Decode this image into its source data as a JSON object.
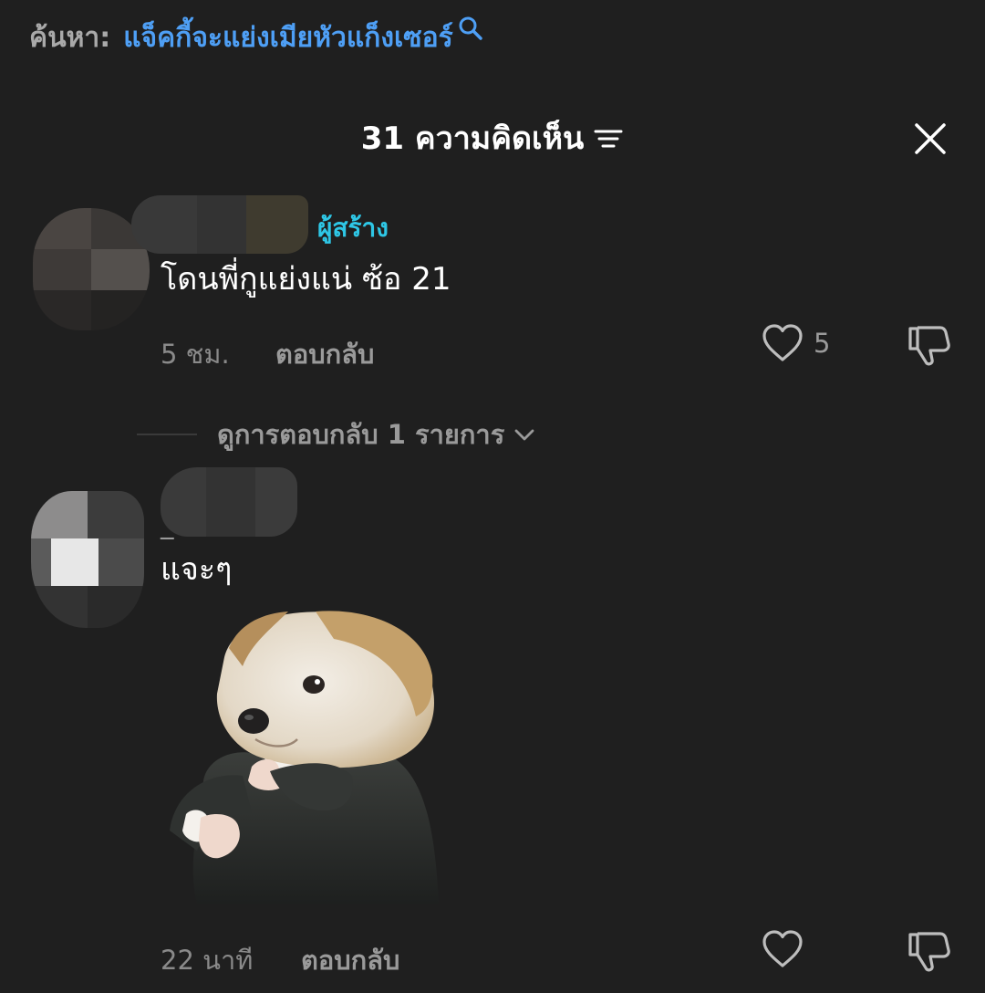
{
  "search": {
    "prefix": "ค้นหา:",
    "query": "แจ็คกี้จะแย่งเมียหัวแก็งเซอร์"
  },
  "header": {
    "title": "31 ความคิดเห็น"
  },
  "comments": [
    {
      "badge": "ผู้สร้าง",
      "text": "โดนพี่กูแย่งแน่ ซ้อ 21",
      "time": "5 ชม.",
      "reply_label": "ตอบกลับ",
      "like_count": "5"
    },
    {
      "username": "_",
      "text": "แจะๆ",
      "time": "22 นาที",
      "reply_label": "ตอบกลับ"
    }
  ],
  "replies_toggle": {
    "label": "ดูการตอบกลับ 1 รายการ"
  },
  "colors": {
    "background": "#1f1f1f",
    "search_query": "#4e9ff5",
    "creator_badge": "#2ec7e6",
    "muted_text": "#9a9a9a"
  },
  "icons": [
    "search-icon",
    "sort-icon",
    "close-icon",
    "heart-icon",
    "thumbs-down-icon",
    "chevron-down-icon"
  ]
}
